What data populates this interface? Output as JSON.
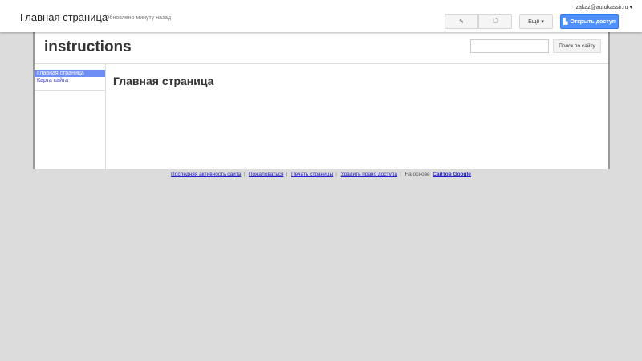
{
  "header": {
    "page_title": "Главная страница",
    "updated": "Обновлено минуту назад",
    "user": "zakaz@autokassir.ru",
    "more_label": "Ещё",
    "share_label": "Открыть доступ"
  },
  "site": {
    "name": "instructions",
    "search_button": "Поиск по сайту",
    "search_value": ""
  },
  "sidebar": {
    "items": [
      {
        "label": "Главная страница"
      },
      {
        "label": "Карта сайта"
      }
    ]
  },
  "main": {
    "heading": "Главная страница"
  },
  "footer": {
    "links": [
      "Последняя активность сайта",
      "Пожаловаться",
      "Печать страницы",
      "Удалить право доступа"
    ],
    "powered": "На основе",
    "google": "Сайтов Google"
  }
}
